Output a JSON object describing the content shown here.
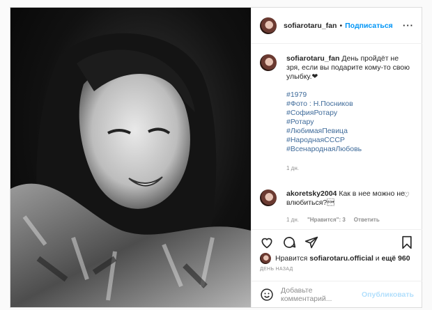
{
  "post": {
    "author": "sofiarotaru_fan",
    "separator": "•",
    "follow_label": "Подписаться",
    "more_label": "···",
    "caption": {
      "user": "sofiarotaru_fan",
      "text": "День пройдёт не зря, если вы подарите кому-то свою улыбку.❤",
      "hashtags": [
        "#1979",
        "#Фото : Н.Посников",
        "#СофияРотару",
        "#Ротару",
        "#ЛюбимаяПевица",
        "#НароднаяСССР",
        "#ВсенароднаяЛюбовь"
      ],
      "time": "1 дн."
    },
    "comment": {
      "user": "akoretsky2004",
      "text": "Как в нее можно не влюбиться?\u0001",
      "time": "1 дн.",
      "likes": "\"Нравится\": 3",
      "reply": "Ответить"
    },
    "likes": {
      "prefix": "Нравится",
      "user": "sofiarotaru.official",
      "mid": "и",
      "count": "ещё 960"
    },
    "date": "ДЕНЬ НАЗАД",
    "add_comment": {
      "placeholder": "Добавьте комментарий...",
      "publish": "Опубликовать"
    }
  }
}
